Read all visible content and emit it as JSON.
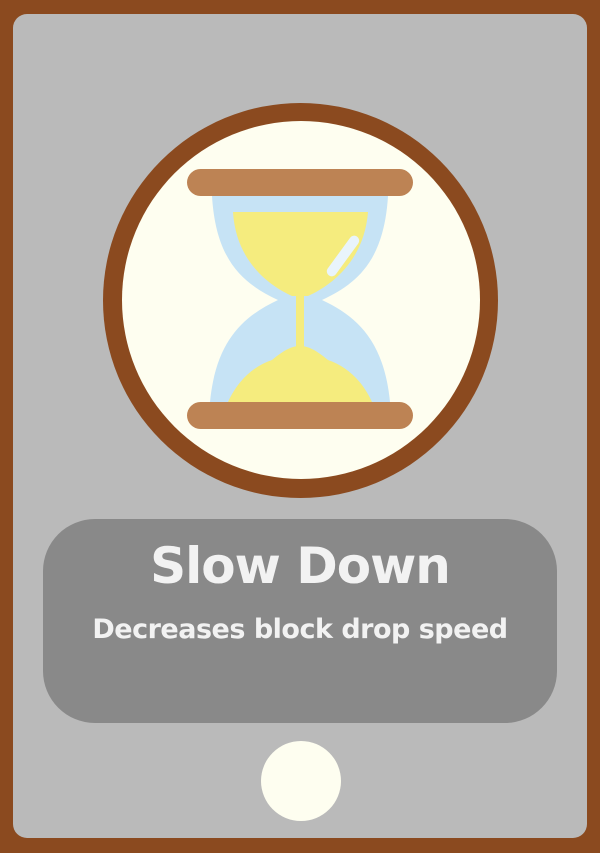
{
  "card": {
    "title": "Slow Down",
    "description": "Decreases block drop speed",
    "icon": "hourglass-icon"
  },
  "colors": {
    "frame": "#8B4A1F",
    "card_background": "#BABABA",
    "panel": "#898989",
    "emblem_face": "#FEFEF0",
    "hourglass_wood": "#BD8354",
    "hourglass_glass": "#C6E3F5",
    "hourglass_sand": "#F5EC7E",
    "text": "#F2F2F2"
  }
}
